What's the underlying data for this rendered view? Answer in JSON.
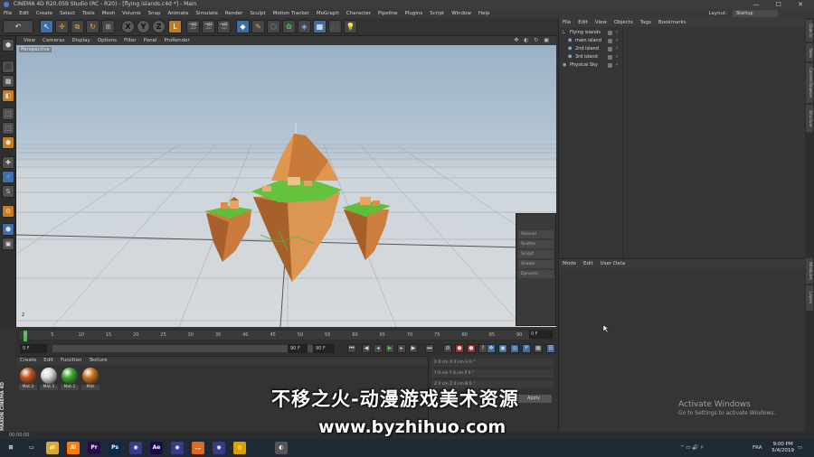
{
  "window": {
    "title": "CINEMA 4D R20.059 Studio (RC - R20) - [flying islands.c4d *] - Main",
    "controls": "—  ☐  ✕"
  },
  "menubar": {
    "items": [
      "File",
      "Edit",
      "Create",
      "Select",
      "Tools",
      "Mesh",
      "Volume",
      "Snap",
      "Animate",
      "Simulate",
      "Render",
      "Sculpt",
      "Motion Tracker",
      "MoGraph",
      "Character",
      "Pipeline",
      "Plugins",
      "Script",
      "Window",
      "Help"
    ],
    "layout_label": "Layout:",
    "layout_value": "Startup"
  },
  "toolbar": {
    "undo": "↶",
    "axis_x": "X",
    "axis_y": "Y",
    "axis_z": "Z"
  },
  "viewport": {
    "menu": [
      "View",
      "Cameras",
      "Display",
      "Options",
      "Filter",
      "Panel",
      "ProRender"
    ],
    "label": "Perspective",
    "corner_icons": "✥ ◐ ↻ ▣",
    "axis_label": "z"
  },
  "overlay_panel": {
    "rows": [
      "Voronoi",
      "Scatter",
      "Sculpt",
      "Shader",
      "Dynamic"
    ]
  },
  "timeline": {
    "ticks": [
      "0",
      "5",
      "10",
      "15",
      "20",
      "25",
      "30",
      "35",
      "40",
      "45",
      "50",
      "55",
      "60",
      "65",
      "70",
      "75",
      "80",
      "85",
      "90"
    ],
    "current_frame": "0 F"
  },
  "transport": {
    "start": "0 F",
    "end_a": "90 F",
    "end_b": "90 F",
    "slider_start": "0 F"
  },
  "material_manager": {
    "menu": [
      "Create",
      "Edit",
      "Function",
      "Texture"
    ],
    "materials": [
      {
        "label": "Mat.2",
        "color": "#c4541c"
      },
      {
        "label": "Mat.1",
        "color": "#d8d8d8"
      },
      {
        "label": "Mat.1",
        "color": "#3ea62e"
      },
      {
        "label": "Mat",
        "color": "#c8741e"
      }
    ]
  },
  "coordinates": {
    "rows": [
      "X  0 cm      X  0 cm      H  0 °",
      "Y  0 cm      Y  0 cm      P  0 °",
      "Z  0 cm      Z  0 cm      B  0 °"
    ],
    "apply": "Apply"
  },
  "object_manager": {
    "menu": [
      "File",
      "Edit",
      "View",
      "Objects",
      "Tags",
      "Bookmarks"
    ],
    "objects": [
      {
        "name": "Flying islands",
        "indent": 0
      },
      {
        "name": "main island",
        "indent": 1
      },
      {
        "name": "2nd island",
        "indent": 1
      },
      {
        "name": "3rd island",
        "indent": 1
      },
      {
        "name": "Physical Sky",
        "indent": 0
      }
    ],
    "check": "✓"
  },
  "attribute_manager": {
    "menu": [
      "Mode",
      "Edit",
      "User Data"
    ]
  },
  "right_tabs": [
    "Objects",
    "Takes",
    "Content Browser",
    "Structure",
    "Attributes",
    "Layers"
  ],
  "activation": {
    "line1": "Activate Windows",
    "line2": "Go to Settings to activate Windows."
  },
  "watermark": {
    "cn": "不移之火-动漫游戏美术资源",
    "url": "www.byzhihuo.com"
  },
  "brand": "MAXON CINEMA 4D",
  "status": "00:00:00",
  "taskbar": {
    "lang": "FRA",
    "time": "9:00 PM",
    "date": "5/4/2019",
    "apps": [
      {
        "label": "⊞",
        "color": "#1f2a36"
      },
      {
        "label": "▭",
        "color": "#1f2a36"
      },
      {
        "label": "📁",
        "color": "#d8a93a"
      },
      {
        "label": "Ai",
        "color": "#ff7c00"
      },
      {
        "label": "Pr",
        "color": "#2a0a4a"
      },
      {
        "label": "Ps",
        "color": "#0a2a4a"
      },
      {
        "label": "◉",
        "color": "#3a3a8a"
      },
      {
        "label": "Ae",
        "color": "#1a0a4a"
      },
      {
        "label": "◉",
        "color": "#3a3a8a"
      },
      {
        "label": "🦊",
        "color": "#e06a1c"
      },
      {
        "label": "◉",
        "color": "#3a3a8a"
      },
      {
        "label": "◎",
        "color": "#d9a000"
      },
      {
        "label": "◐",
        "color": "#555555"
      }
    ]
  },
  "colors": {
    "accent_orange": "#c67d1f",
    "accent_blue": "#3f6fa8",
    "island_rock": "#d9884a",
    "island_grass": "#5fbf3a"
  }
}
